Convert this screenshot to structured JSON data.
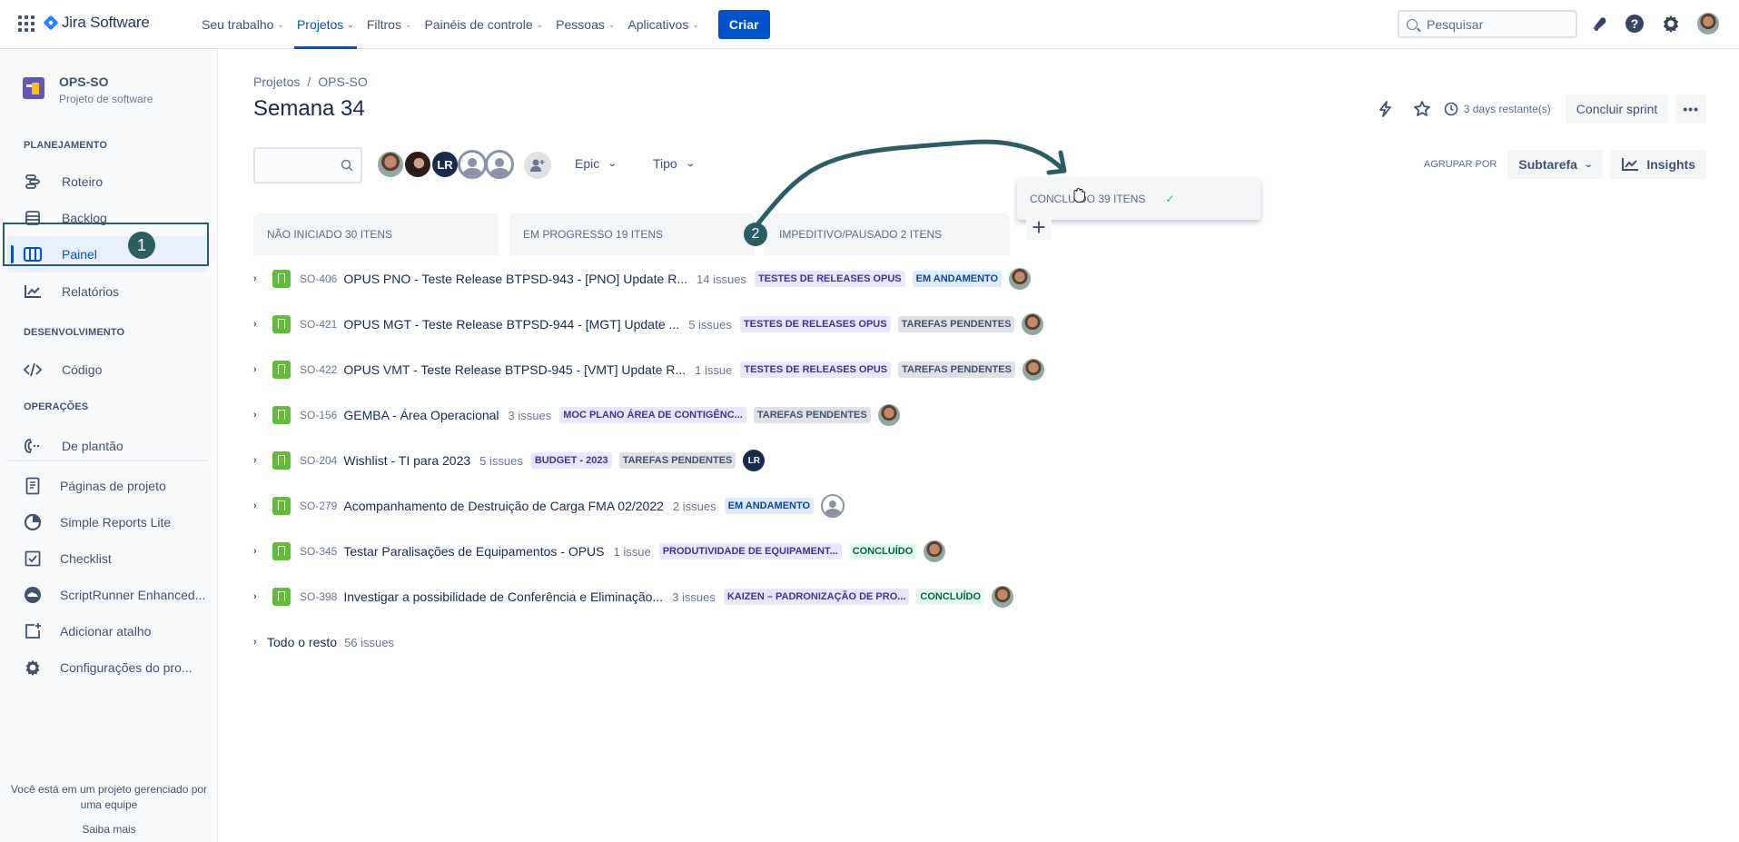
{
  "topnav": {
    "app_name": "Jira Software",
    "items": [
      {
        "label": "Seu trabalho",
        "active": false
      },
      {
        "label": "Projetos",
        "active": true
      },
      {
        "label": "Filtros",
        "active": false
      },
      {
        "label": "Painéis de controle",
        "active": false
      },
      {
        "label": "Pessoas",
        "active": false
      },
      {
        "label": "Aplicativos",
        "active": false
      }
    ],
    "create_label": "Criar",
    "search_placeholder": "Pesquisar",
    "icons": [
      "notifications-icon",
      "help-icon",
      "settings-icon",
      "profile-avatar"
    ]
  },
  "sidebar": {
    "project_name": "OPS-SO",
    "project_type": "Projeto de software",
    "sections": [
      {
        "heading": "PLANEJAMENTO",
        "items": [
          {
            "label": "Roteiro",
            "icon": "roadmap-icon"
          },
          {
            "label": "Backlog",
            "icon": "backlog-icon"
          },
          {
            "label": "Painel",
            "icon": "board-icon",
            "active": true
          },
          {
            "label": "Relatórios",
            "icon": "reports-icon"
          }
        ]
      },
      {
        "heading": "DESENVOLVIMENTO",
        "items": [
          {
            "label": "Código",
            "icon": "code-icon"
          }
        ]
      },
      {
        "heading": "OPERAÇÕES",
        "items": [
          {
            "label": "De plantão",
            "icon": "on-call-icon"
          }
        ]
      }
    ],
    "extra_items": [
      {
        "label": "Páginas de projeto",
        "icon": "pages-icon"
      },
      {
        "label": "Simple Reports Lite",
        "icon": "pie-chart-icon"
      },
      {
        "label": "Checklist",
        "icon": "checklist-icon"
      },
      {
        "label": "ScriptRunner Enhanced...",
        "icon": "scriptrunner-icon"
      },
      {
        "label": "Adicionar atalho",
        "icon": "add-shortcut-icon"
      },
      {
        "label": "Configurações do pro...",
        "icon": "settings-icon"
      }
    ],
    "footer_text": "Você está em um projeto gerenciado por uma equipe",
    "footer_link": "Saiba mais"
  },
  "annotations": {
    "step1": "1",
    "step2": "2",
    "color": "#2b5e62"
  },
  "main": {
    "breadcrumb": [
      "Projetos",
      "OPS-SO"
    ],
    "breadcrumb_sep": "/",
    "title": "Semana 34",
    "days_remaining": "3 days restante(s)",
    "complete_sprint_label": "Concluir sprint",
    "more_label": "•••",
    "filter_avatars": [
      {
        "type": "photo",
        "label": ""
      },
      {
        "type": "photo2",
        "label": ""
      },
      {
        "type": "initials",
        "label": "LR"
      },
      {
        "type": "ghost",
        "label": ""
      },
      {
        "type": "ghost",
        "label": ""
      }
    ],
    "epic_filter": "Epic",
    "type_filter": "Tipo",
    "group_by_label": "AGRUPAR POR",
    "group_by_value": "Subtarefa",
    "insights_label": "Insights"
  },
  "columns": [
    {
      "title": "NÃO INICIADO 30 ITENS"
    },
    {
      "title": "EM PROGRESSO 19 ITENS"
    },
    {
      "title": "IMPEDITIVO/PAUSADO 2 ITENS"
    },
    {
      "title": "CONCLUÍDO 39 ITENS",
      "dragging": true,
      "check": "✓"
    }
  ],
  "swimlanes": [
    {
      "key": "SO-406",
      "summary": "OPUS PNO - Teste Release BTPSD-943 - [PNO] Update R...",
      "count": "14 issues",
      "epic": "TESTES DE RELEASES OPUS",
      "status": "EM ANDAMENTO",
      "status_type": "progress",
      "assignee": "photo"
    },
    {
      "key": "SO-421",
      "summary": "OPUS MGT - Teste Release BTPSD-944 - [MGT] Update ...",
      "count": "5 issues",
      "epic": "TESTES DE RELEASES OPUS",
      "status": "TAREFAS PENDENTES",
      "status_type": "todo",
      "assignee": "photo"
    },
    {
      "key": "SO-422",
      "summary": "OPUS VMT - Teste Release BTPSD-945 - [VMT] Update R...",
      "count": "1 issue",
      "epic": "TESTES DE RELEASES OPUS",
      "status": "TAREFAS PENDENTES",
      "status_type": "todo",
      "assignee": "photo"
    },
    {
      "key": "SO-156",
      "summary": "GEMBA - Área Operacional",
      "count": "3 issues",
      "epic": "MOC PLANO ÁREA DE CONTIGÊNC...",
      "status": "TAREFAS PENDENTES",
      "status_type": "todo",
      "assignee": "photo"
    },
    {
      "key": "SO-204",
      "summary": "Wishlist - TI para 2023",
      "count": "5 issues",
      "epic": "BUDGET - 2023",
      "status": "TAREFAS PENDENTES",
      "status_type": "todo",
      "assignee": "initials",
      "assignee_label": "LR"
    },
    {
      "key": "SO-279",
      "summary": "Acompanhamento de Destruição de Carga FMA 02/2022",
      "count": "2 issues",
      "epic": "",
      "status": "EM ANDAMENTO",
      "status_type": "progress",
      "assignee": "ghost"
    },
    {
      "key": "SO-345",
      "summary": "Testar Paralisações de Equipamentos - OPUS",
      "count": "1 issue",
      "epic": "PRODUTIVIDADE DE EQUIPAMENT...",
      "status": "CONCLUÍDO",
      "status_type": "done",
      "assignee": "photo"
    },
    {
      "key": "SO-398",
      "summary": "Investigar a possibilidade de Conferência e Eliminação...",
      "count": "3 issues",
      "epic": "KAIZEN – PADRONIZAÇÃO DE PRO...",
      "status": "CONCLUÍDO",
      "status_type": "done",
      "assignee": "photo"
    }
  ],
  "rest": {
    "label": "Todo o resto",
    "count": "56 issues"
  }
}
